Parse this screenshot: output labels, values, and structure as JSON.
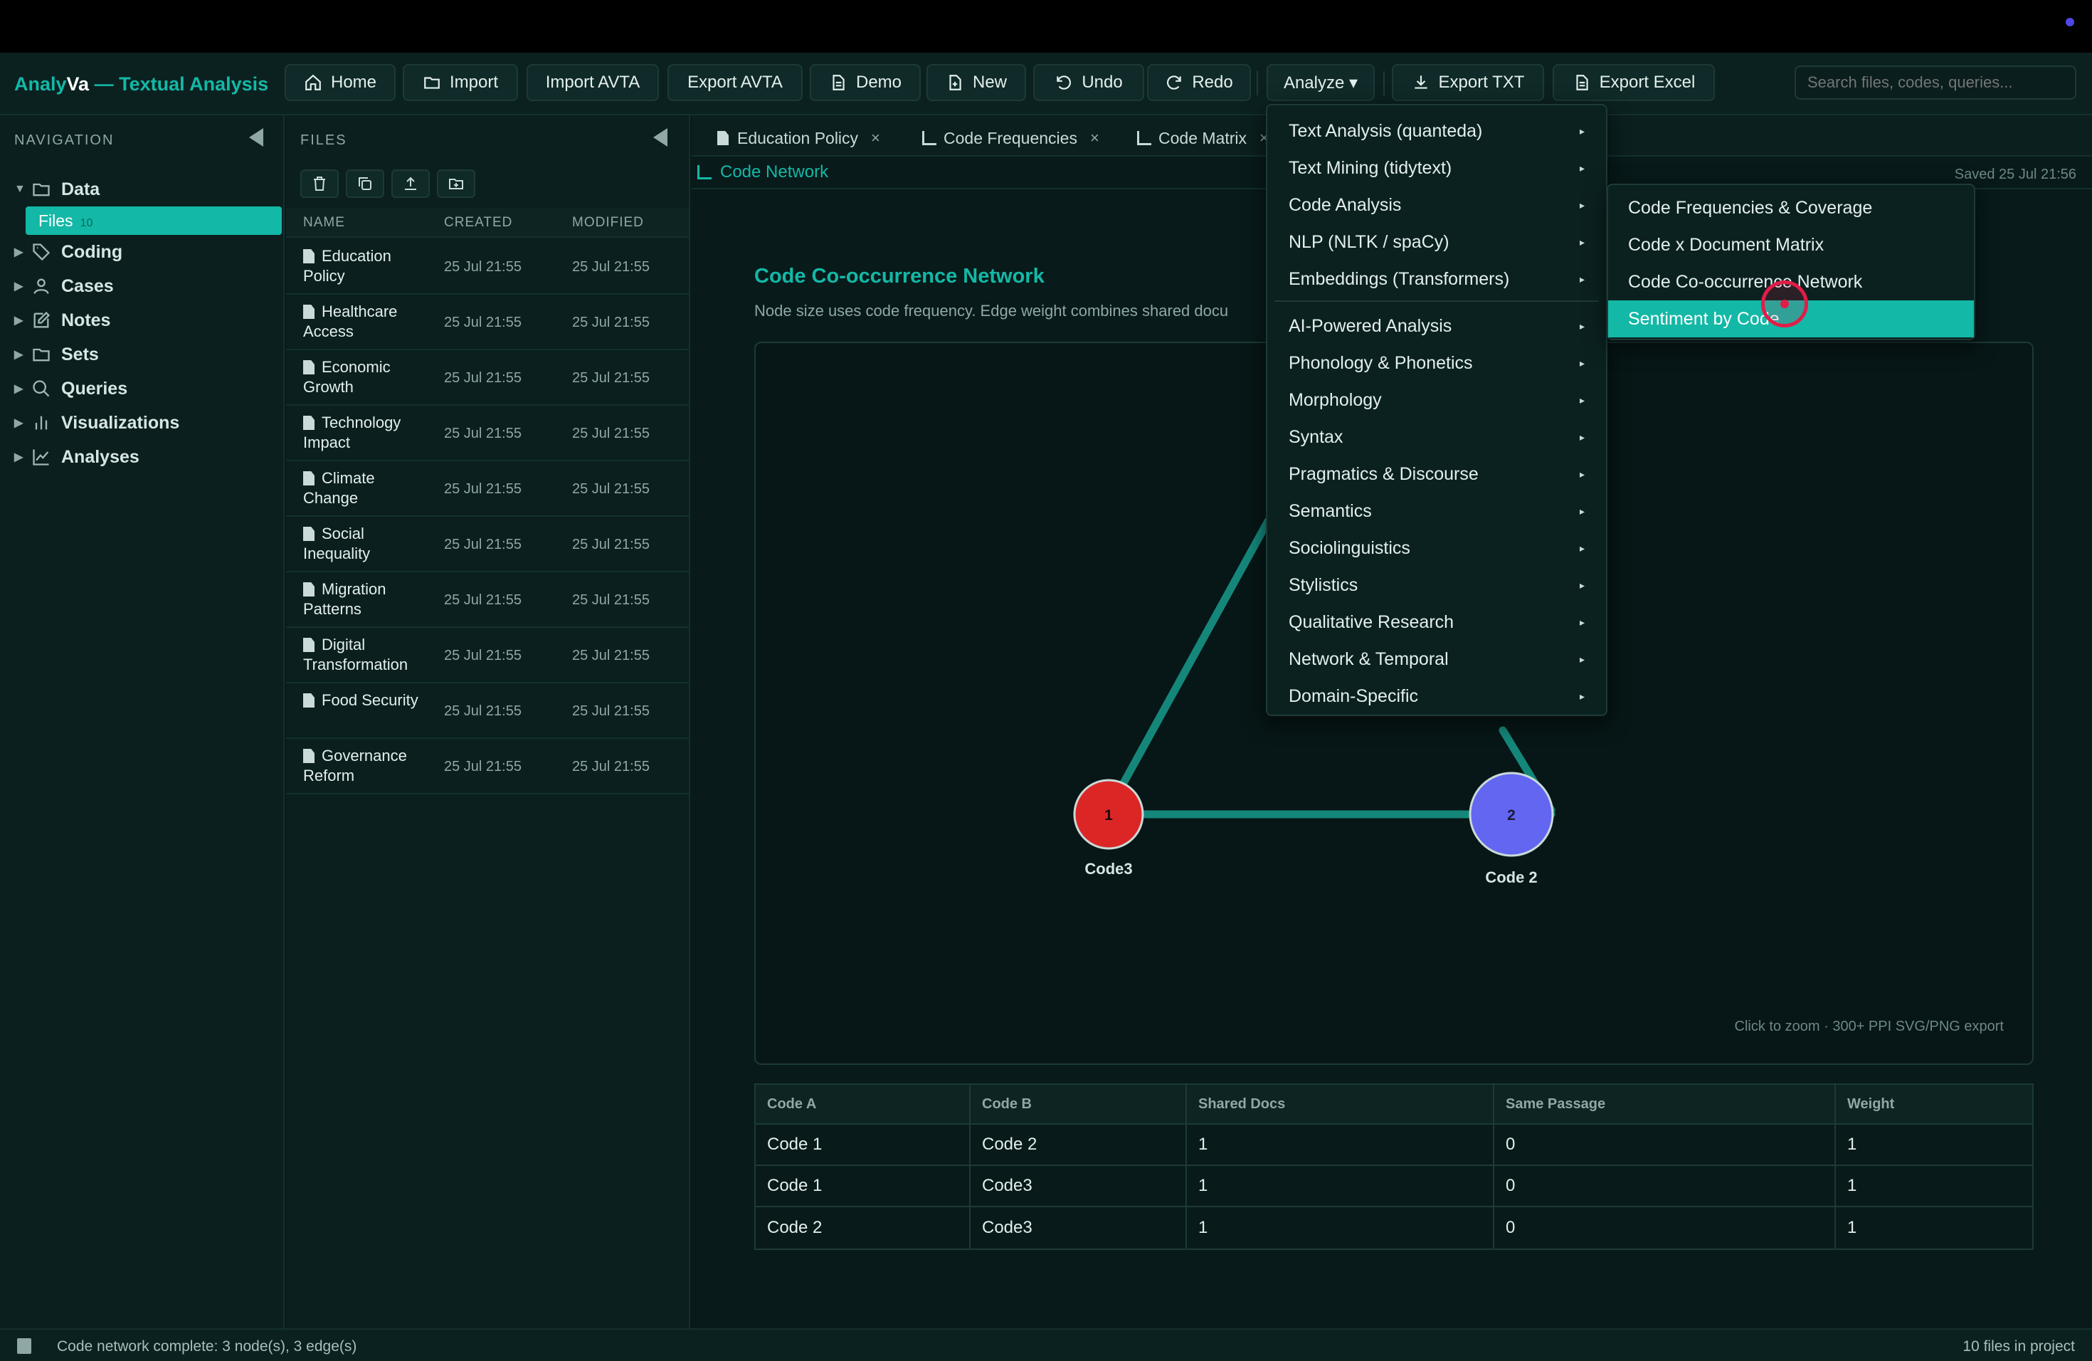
{
  "app": {
    "brand_part1": "Analy",
    "brand_part2": "Va",
    "brand_part3": " — Textual Analysis"
  },
  "toolbar": {
    "home": "Home",
    "import": "Import",
    "import_avta": "Import AVTA",
    "export_avta": "Export AVTA",
    "demo": "Demo",
    "new": "New",
    "undo": "Undo",
    "redo": "Redo",
    "analyze": "Analyze ▾",
    "export_txt": "Export TXT",
    "export_excel": "Export Excel",
    "search_placeholder": "Search files, codes, queries..."
  },
  "navigation": {
    "title": "NAVIGATION",
    "items": [
      {
        "label": "Data",
        "icon": "folder-icon",
        "expanded": true
      },
      {
        "label": "Coding",
        "icon": "tag-icon"
      },
      {
        "label": "Cases",
        "icon": "person-icon"
      },
      {
        "label": "Notes",
        "icon": "note-icon"
      },
      {
        "label": "Sets",
        "icon": "folder-icon"
      },
      {
        "label": "Queries",
        "icon": "search-icon"
      },
      {
        "label": "Visualizations",
        "icon": "bar-chart-icon"
      },
      {
        "label": "Analyses",
        "icon": "line-chart-icon"
      }
    ],
    "files_label": "Files",
    "files_count": "10"
  },
  "files": {
    "title": "FILES",
    "columns": [
      "NAME",
      "CREATED",
      "MODIFIED"
    ],
    "rows": [
      {
        "name": "Education Policy",
        "created": "25 Jul 21:55",
        "modified": "25 Jul 21:55"
      },
      {
        "name": "Healthcare Access",
        "created": "25 Jul 21:55",
        "modified": "25 Jul 21:55"
      },
      {
        "name": "Economic Growth",
        "created": "25 Jul 21:55",
        "modified": "25 Jul 21:55"
      },
      {
        "name": "Technology Impact",
        "created": "25 Jul 21:55",
        "modified": "25 Jul 21:55"
      },
      {
        "name": "Climate Change",
        "created": "25 Jul 21:55",
        "modified": "25 Jul 21:55"
      },
      {
        "name": "Social Inequality",
        "created": "25 Jul 21:55",
        "modified": "25 Jul 21:55"
      },
      {
        "name": "Migration Patterns",
        "created": "25 Jul 21:55",
        "modified": "25 Jul 21:55"
      },
      {
        "name": "Digital Transformation",
        "created": "25 Jul 21:55",
        "modified": "25 Jul 21:55"
      },
      {
        "name": "Food Security",
        "created": "25 Jul 21:55",
        "modified": "25 Jul 21:55"
      },
      {
        "name": "Governance Reform",
        "created": "25 Jul 21:55",
        "modified": "25 Jul 21:55"
      }
    ]
  },
  "tabs": [
    {
      "label": "Education Policy",
      "kind": "document"
    },
    {
      "label": "Code Frequencies",
      "kind": "chart"
    },
    {
      "label": "Code Matrix",
      "kind": "chart"
    }
  ],
  "active_tab": "Code Network",
  "saved_text": "Saved 25 Jul 21:56",
  "network": {
    "title": "Code Co-occurrence Network",
    "description": "Node size uses code frequency. Edge weight combines shared docu",
    "hint": "Click to zoom · 300+ PPI SVG/PNG export",
    "nodes": [
      {
        "id": "1",
        "label": "Code3",
        "color": "#dc2626"
      },
      {
        "id": "2",
        "label": "Code 2",
        "color": "#6366f1"
      }
    ],
    "edge_color": "#14877a"
  },
  "table": {
    "columns": [
      "Code A",
      "Code B",
      "Shared Docs",
      "Same Passage",
      "Weight"
    ],
    "rows": [
      [
        "Code 1",
        "Code 2",
        "1",
        "0",
        "1"
      ],
      [
        "Code 1",
        "Code3",
        "1",
        "0",
        "1"
      ],
      [
        "Code 2",
        "Code3",
        "1",
        "0",
        "1"
      ]
    ]
  },
  "analyze_menu": {
    "items": [
      "Text Analysis (quanteda)",
      "Text Mining (tidytext)",
      "Code Analysis",
      "NLP (NLTK / spaCy)",
      "Embeddings (Transformers)",
      "AI-Powered Analysis",
      "Phonology & Phonetics",
      "Morphology",
      "Syntax",
      "Pragmatics & Discourse",
      "Semantics",
      "Sociolinguistics",
      "Stylistics",
      "Qualitative Research",
      "Network & Temporal",
      "Domain-Specific"
    ],
    "submenu": [
      "Code Frequencies & Coverage",
      "Code x Document Matrix",
      "Code Co-occurrence Network",
      "Sentiment by Code"
    ],
    "highlighted": "Sentiment by Code"
  },
  "status": {
    "left": "Code network complete: 3 node(s), 3 edge(s)",
    "right": "10 files in project"
  },
  "colors": {
    "accent": "#14b8a6",
    "background": "#081a1a"
  }
}
